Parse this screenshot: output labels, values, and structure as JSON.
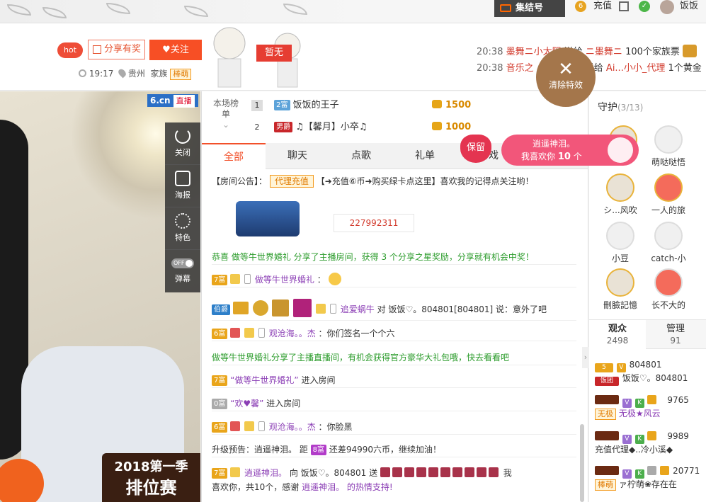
{
  "topbar": {
    "jiehao": "集结号",
    "recharge": "充值",
    "username": "饭饭"
  },
  "header": {
    "hot_badge": "hot",
    "share_label": "分享有奖",
    "follow_label": "关注",
    "time": "19:17",
    "location": "贵州",
    "family_label": "家族",
    "family_tag": "棒萌",
    "zanwu": "暂无",
    "clear_fx": "清除特效",
    "gift_msgs": [
      {
        "time": "20:38",
        "from": "墨舞ニ小太阳",
        "verb": "送给",
        "to": "ニ墨舞ニ",
        "gift": "100个家族票"
      },
      {
        "time": "20:38",
        "from": "音乐之",
        "verb": "送给",
        "to": "Ai...小小_代理",
        "gift": "1个黄金"
      }
    ]
  },
  "video": {
    "brand": "6.cn",
    "live": "直播",
    "tools": [
      {
        "label": "关闭",
        "icon": "power-icon"
      },
      {
        "label": "海报",
        "icon": "poster-icon"
      },
      {
        "label": "特色",
        "icon": "feature-icon"
      },
      {
        "label": "弹幕",
        "icon": "danmaku-icon",
        "toggle": "OFF"
      }
    ],
    "season_l1": "2018第一季",
    "season_l2": "排位赛"
  },
  "rank": {
    "label": "本场榜单",
    "rows": [
      {
        "num": "1",
        "level": "2富",
        "name": "饭饭的王子",
        "amount": "1500"
      },
      {
        "num": "2",
        "level": "男爵",
        "name": "♫【馨月】小卒♫",
        "amount": "1000"
      }
    ]
  },
  "tabs": [
    "全部",
    "聊天",
    "点歌",
    "礼单",
    "游戏"
  ],
  "favorite": {
    "heart": "保留",
    "line1": "逍遥神泪。",
    "line2_prefix": "我喜欢你",
    "count": "10",
    "line2_suffix": "个"
  },
  "chat": {
    "notice_prefix": "【房间公告】：",
    "notice_tag": "代理充值",
    "notice_text": "【➜充值⑥币➜购买绿卡点这里】喜欢我的记得点关注哟！",
    "room_id": "227992311",
    "sys1": "恭喜 做等牛世界婚礼 分享了主播房间，获得 3 个分享之星奖励，分享就有机会中奖！",
    "lines": [
      {
        "level": "7富",
        "name": "做等牛世界婚礼",
        "text": "："
      },
      {
        "level": "伯爵",
        "name": "追爱蜗牛",
        "text": "对 饭饭♡。804801[804801] 说：意外了吧"
      },
      {
        "level": "6富",
        "name": "观沧海。。杰",
        "text": "：你们签名一个个六"
      },
      {
        "level": "",
        "name": "",
        "text": "做等牛世界婚礼分享了主播直播间，有机会获得官方豪华大礼包哦，快去看看吧"
      },
      {
        "level": "7富",
        "name": "“做等牛世界婚礼”",
        "text": "进入房间"
      },
      {
        "level": "0富",
        "name": "“欢♥馨”",
        "text": "进入房间"
      },
      {
        "level": "6富",
        "name": "观沧海。。杰",
        "text": "：你脸黑"
      },
      {
        "level": "8富",
        "name": "升级预告：逍遥神泪。 距",
        "text": "还差94990六币，继续加油！"
      },
      {
        "level": "7富",
        "name": "逍遥神泪。",
        "text": "向 饭饭♡。804801 送"
      },
      {
        "level": "",
        "name": "喜欢你，共10个，感谢",
        "text": "逍遥神泪。 的热情支持!"
      }
    ],
    "gift_tail": "我"
  },
  "guard": {
    "title": "守护",
    "count": "(3/13)",
    "items": [
      "",
      "萌哒哒悟",
      "シ...风吹",
      "一人的旅",
      "小豆",
      "catch-小",
      "刪臉記憶",
      "长不大的"
    ]
  },
  "viewers": {
    "tab1": "观众",
    "tab1_count": "2498",
    "tab2": "管理",
    "tab2_count": "91",
    "rows": [
      {
        "line1": "804801",
        "line2": "饭饭♡。804801",
        "tag": "饭团"
      },
      {
        "line1": "9765",
        "line2": "无极★风云",
        "tag": "无极"
      },
      {
        "line1": "9989",
        "line2": "充值代理◆..冷小溪◆",
        "tag": ""
      },
      {
        "line1": "20771",
        "line2": "ァ柠萌❀存在在",
        "tag": "棒萌"
      }
    ]
  },
  "colors": {
    "accent": "#f2502a",
    "hot": "#ee4d37",
    "pink": "#f2567a",
    "brown": "#a4764b"
  }
}
